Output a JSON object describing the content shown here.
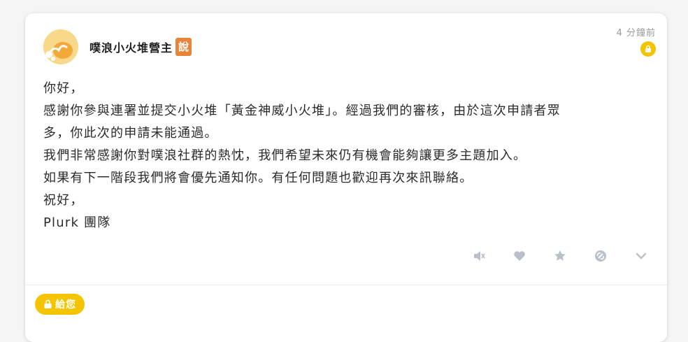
{
  "post": {
    "author": "噗浪小火堆營主",
    "qualifier": "說",
    "time": "4 分鐘前",
    "lines": [
      "你好，",
      "感謝你參與連署並提交小火堆「黃金神威小火堆」。經過我們的審核，由於這次申請者眾",
      "多，你此次的申請未能通過。",
      "我們非常感謝你對噗浪社群的熱忱，我們希望未來仍有機會能夠讓更多主題加入。",
      "如果有下一階段我們將會優先通知你。有任何問題也歡迎再次來訊聯絡。",
      "祝好，",
      "Plurk 團隊"
    ],
    "private_label": "給您"
  },
  "icons": {
    "lock": "lock-icon",
    "mute": "mute-icon",
    "like": "heart-icon",
    "replurk": "star-icon",
    "link": "link-icon",
    "more": "chevron-down-icon"
  },
  "colors": {
    "accent_yellow": "#f5c400",
    "qualifier_orange": "#e8833a",
    "icon_gray": "#b9c0c9"
  }
}
